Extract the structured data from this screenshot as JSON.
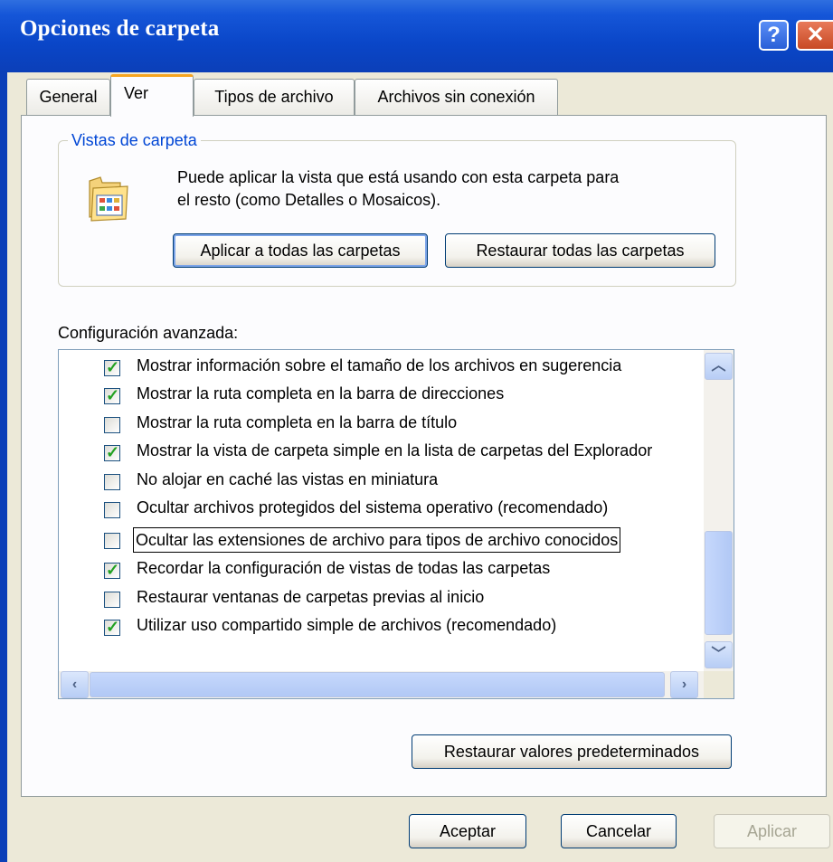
{
  "window": {
    "title": "Opciones de carpeta",
    "help_glyph": "?",
    "close_glyph": "✕"
  },
  "tabs": [
    {
      "label": "General"
    },
    {
      "label": "Ver",
      "active": true
    },
    {
      "label": "Tipos de archivo"
    },
    {
      "label": "Archivos sin conexión"
    }
  ],
  "folder_views": {
    "group_label": "Vistas de carpeta",
    "description_line1": "Puede aplicar la vista que está usando con esta carpeta para",
    "description_line2": "el resto (como Detalles o Mosaicos).",
    "apply_all_label": "Aplicar a todas las carpetas",
    "reset_all_label": "Restaurar todas las carpetas"
  },
  "advanced": {
    "label": "Configuración avanzada:",
    "items": [
      {
        "label": "Mostrar información sobre el tamaño de los archivos en sugerencia",
        "checked": true
      },
      {
        "label": "Mostrar la ruta completa en la barra de direcciones",
        "checked": true
      },
      {
        "label": "Mostrar la ruta completa en la barra de título",
        "checked": false
      },
      {
        "label": "Mostrar la vista de carpeta simple en la lista de carpetas del Explorador",
        "checked": true
      },
      {
        "label": "No alojar en caché las vistas en miniatura",
        "checked": false
      },
      {
        "label": "Ocultar archivos protegidos del sistema operativo (recomendado)",
        "checked": false
      },
      {
        "label": "Ocultar las extensiones de archivo para tipos de archivo conocidos",
        "checked": false,
        "focused": true
      },
      {
        "label": "Recordar la configuración de vistas de todas las carpetas",
        "checked": true
      },
      {
        "label": "Restaurar ventanas de carpetas previas al inicio",
        "checked": false
      },
      {
        "label": "Utilizar uso compartido simple de archivos (recomendado)",
        "checked": true
      }
    ],
    "restore_defaults_label": "Restaurar valores predeterminados"
  },
  "footer": {
    "ok_label": "Aceptar",
    "cancel_label": "Cancelar",
    "apply_label": "Aplicar"
  },
  "colors": {
    "titlebar": "#0a46c8",
    "dialog_bg": "#ece9d8",
    "group_label": "#0046d5",
    "active_tab_accent": "#f7a520",
    "check": "#21a121"
  },
  "icons": {
    "folder_views": "folder-views-icon",
    "help": "help-icon",
    "close": "close-icon"
  }
}
